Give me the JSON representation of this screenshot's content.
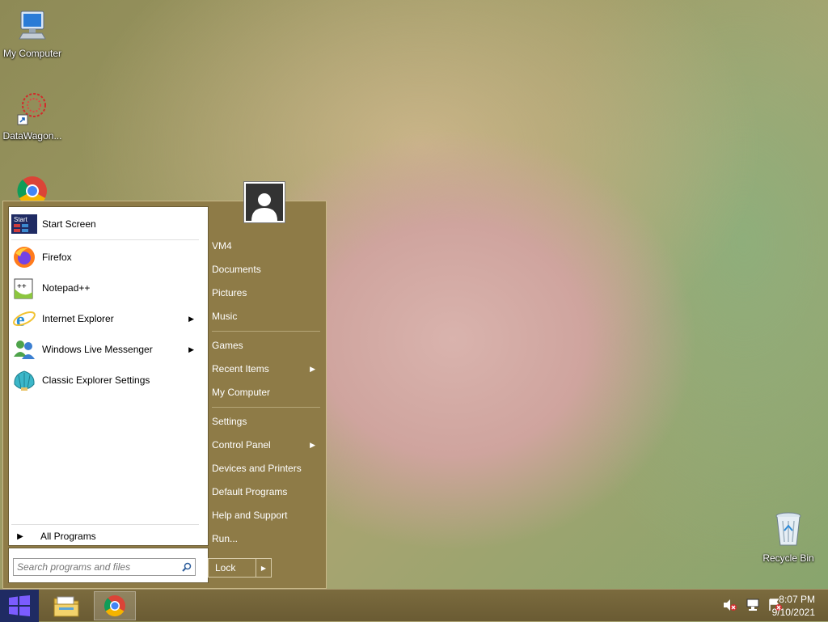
{
  "desktop": {
    "icons": [
      {
        "label": "My Computer"
      },
      {
        "label": "DataWagon..."
      },
      {
        "label": "Recycle Bin"
      }
    ]
  },
  "start_menu": {
    "pinned": [
      {
        "label": "Start Screen",
        "icon": "start-screen-icon"
      },
      {
        "label": "Firefox",
        "icon": "firefox-icon"
      },
      {
        "label": "Notepad++",
        "icon": "notepad-plus-plus-icon"
      },
      {
        "label": "Internet Explorer",
        "icon": "internet-explorer-icon",
        "submenu": true
      },
      {
        "label": "Windows Live Messenger",
        "icon": "messenger-icon",
        "submenu": true
      },
      {
        "label": "Classic Explorer Settings",
        "icon": "shell-icon"
      }
    ],
    "start_screen_badge": "Start",
    "all_programs": "All Programs",
    "search_placeholder": "Search programs and files",
    "right_links": {
      "user": "VM4",
      "documents": "Documents",
      "pictures": "Pictures",
      "music": "Music",
      "games": "Games",
      "recent_items": "Recent Items",
      "my_computer": "My Computer",
      "settings": "Settings",
      "control_panel": "Control Panel",
      "devices_printers": "Devices and Printers",
      "default_programs": "Default Programs",
      "help_support": "Help and Support",
      "run": "Run..."
    },
    "lock_label": "Lock"
  },
  "taskbar": {
    "time": "8:07 PM",
    "date": "9/10/2021"
  },
  "colors": {
    "menu_bg": "#8e7b47",
    "taskbar": "#6f5f36",
    "start_button": "#1f2b63"
  }
}
